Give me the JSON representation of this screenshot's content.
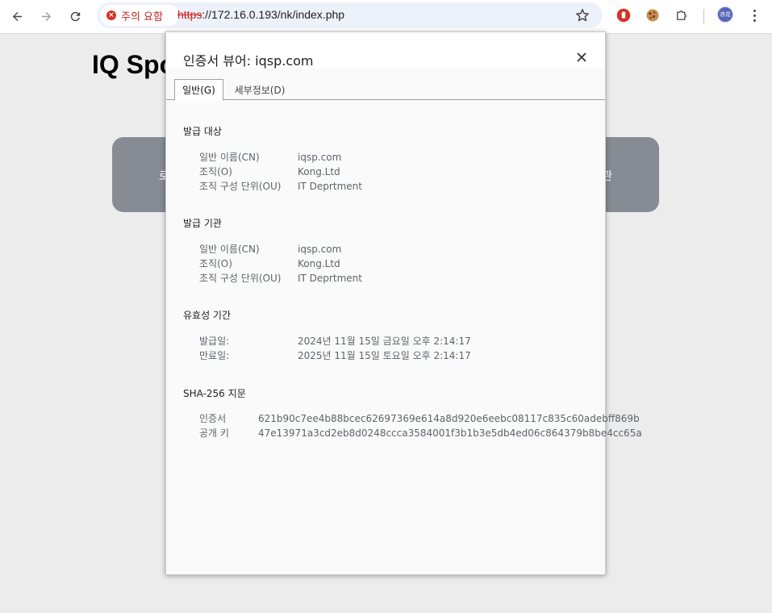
{
  "browser": {
    "security_chip": "주의 요함",
    "url_scheme": "https",
    "url_rest": "://172.16.0.193/nk/index.php",
    "avatar_text": "凉花",
    "colors": {
      "warning": "#d93025",
      "omnibox_bg": "#edf1f9"
    },
    "icons": [
      "back-icon",
      "forward-icon",
      "reload-icon",
      "star-icon",
      "stop-hand-icon",
      "cookie-icon",
      "puzzle-icon",
      "kebab-menu-icon"
    ]
  },
  "page": {
    "title": "IQ Spo",
    "card_left": "로",
    "card_right": "관"
  },
  "dialog": {
    "title": "인증서 뷰어: iqsp.com",
    "tabs": [
      {
        "label": "일반(G)",
        "active": true
      },
      {
        "label": "세부정보(D)",
        "active": false
      }
    ],
    "issued_to": {
      "heading": "발급 대상",
      "rows": [
        {
          "key": "일반 이름(CN)",
          "value": "iqsp.com"
        },
        {
          "key": "조직(O)",
          "value": "Kong.Ltd"
        },
        {
          "key": "조직 구성 단위(OU)",
          "value": "IT Deprtment"
        }
      ]
    },
    "issued_by": {
      "heading": "발급 기관",
      "rows": [
        {
          "key": "일반 이름(CN)",
          "value": "iqsp.com"
        },
        {
          "key": "조직(O)",
          "value": "Kong.Ltd"
        },
        {
          "key": "조직 구성 단위(OU)",
          "value": "IT Deprtment"
        }
      ]
    },
    "validity": {
      "heading": "유효성 기간",
      "rows": [
        {
          "key": "발급일:",
          "value": "2024년 11월 15일 금요일 오후 2:14:17"
        },
        {
          "key": "만료일:",
          "value": "2025년 11월 15일 토요일 오후 2:14:17"
        }
      ]
    },
    "fingerprints": {
      "heading": "SHA-256 지문",
      "rows": [
        {
          "key": "인증서",
          "value": "621b90c7ee4b88bcec62697369e614a8d920e6eebc08117c835c60adebff869b"
        },
        {
          "key": "공개 키",
          "value": "47e13971a3cd2eb8d0248ccca3584001f3b1b3e5db4ed06c864379b8be4cc65a"
        }
      ]
    }
  }
}
